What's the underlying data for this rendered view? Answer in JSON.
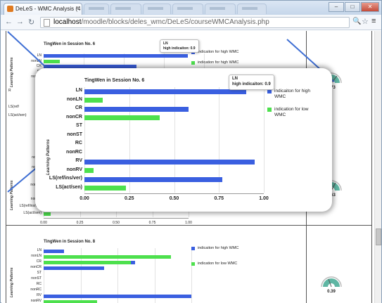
{
  "browser": {
    "tab_title": "DeLeS - WMC Analysis (4",
    "url_host": "localhost",
    "url_path": "/moodle/blocks/deles_wmc/DeLeS/courseWMCAnalysis.php",
    "window_controls": [
      "–",
      "□",
      "✕"
    ]
  },
  "colors": {
    "blue": "#3a5fe0",
    "green": "#4de04d",
    "line": "#3f6fd4",
    "gauge": "#5fb6a3"
  },
  "zoom_panel": {
    "chart_data": {
      "type": "bar",
      "title": "TingWen in Session No. 6",
      "ylabel": "Learning Patterns",
      "orientation": "horizontal",
      "categories": [
        "LN",
        "nonLN",
        "CR",
        "nonCR",
        "ST",
        "nonST",
        "RC",
        "nonRC",
        "RV",
        "nonRV",
        "LS(ref/ins/ver)",
        "LS(act/sen)"
      ],
      "series": [
        {
          "name": "indicaiton for high WMC",
          "values": [
            0.9,
            null,
            0.58,
            null,
            null,
            null,
            null,
            null,
            0.95,
            null,
            0.77,
            null
          ]
        },
        {
          "name": "indication for low WMC",
          "values": [
            null,
            0.1,
            null,
            0.42,
            null,
            null,
            null,
            null,
            null,
            0.05,
            null,
            0.23
          ]
        }
      ],
      "xticks": [
        "0.00",
        "0.25",
        "0.50",
        "0.75",
        "1.00"
      ],
      "xlim": [
        0,
        1
      ],
      "legend_position": "right"
    },
    "tooltip": {
      "title": "LN",
      "text": "high indicaiton: 0.9"
    }
  },
  "panel_1": {
    "chart_data": {
      "type": "bar",
      "title": "TingWen in Session No. 6",
      "ylabel": "Learning Patterns",
      "orientation": "horizontal",
      "categories": [
        "LN",
        "nonLN",
        "CR",
        "ST",
        "nonST"
      ],
      "series": [
        {
          "name": "indicaiton for high WMC",
          "values": [
            0.9,
            null,
            0.58,
            0.0,
            null
          ]
        },
        {
          "name": "indication for high WMC",
          "values": [
            null,
            0.1,
            null,
            null,
            null
          ]
        }
      ],
      "xlim": [
        0,
        1
      ],
      "legend_position": "right"
    },
    "labels_partial": [
      "R",
      "LS(ref/",
      "LS(act/sen)"
    ],
    "tooltip": {
      "title": "LN",
      "text": "high indicaiton: 0.9"
    },
    "gauge_value": "0.73"
  },
  "panel_2": {
    "chart_data": {
      "type": "bar",
      "ylabel": "Learning Patterns",
      "orientation": "horizontal",
      "categories": [
        "RC",
        "nonRC",
        "RV",
        "nonRV",
        "LS(ref/ins/ver)",
        "LS(act/sen)"
      ],
      "series": [
        {
          "name": "high",
          "values": [
            null,
            null,
            0.75,
            null,
            0.58,
            null
          ]
        },
        {
          "name": "low",
          "values": [
            null,
            null,
            null,
            null,
            null,
            0.05
          ]
        }
      ],
      "xticks": [
        "0.00",
        "0.25",
        "0.50",
        "0.75",
        "1.00"
      ],
      "xlim": [
        0,
        1
      ]
    },
    "top_labels": [
      "nonLN",
      "ST",
      "nonST"
    ],
    "gauge_value": "0.63"
  },
  "panel_3": {
    "chart_data": {
      "type": "bar",
      "title": "TingWen in Session No. 8",
      "ylabel": "Learning Patterns",
      "orientation": "horizontal",
      "categories": [
        "LN",
        "nonLN",
        "CR",
        "nonCR",
        "ST",
        "nonST",
        "RC",
        "nonRC",
        "RV",
        "nonRV"
      ],
      "series": [
        {
          "name": "indicaiton for high WMC",
          "values": [
            0.14,
            null,
            0.62,
            0.41,
            null,
            null,
            null,
            null,
            1.0,
            null
          ]
        },
        {
          "name": "indication for low WMC",
          "values": [
            null,
            0.86,
            0.59,
            null,
            null,
            null,
            null,
            null,
            null,
            0.36
          ]
        }
      ],
      "xlim": [
        0,
        1
      ],
      "legend_position": "right"
    },
    "gauge_value": "0.39"
  }
}
